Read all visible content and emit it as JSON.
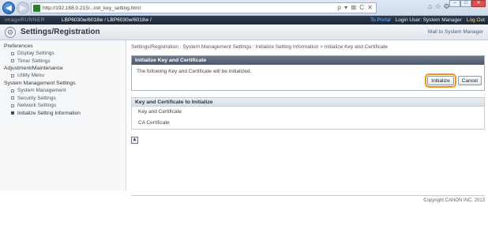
{
  "browser": {
    "url": "http://192.168.0.215/...init_key_setting.html",
    "addr_tools": "ρ ▾ ⊠ C ✕",
    "tab_tools": [
      "⌂",
      "☆",
      "⚙"
    ]
  },
  "device": {
    "logo": "imageRUNNER",
    "name": "LBP6030w/6018w / LBP6030w/6018w /",
    "portal": "To Portal",
    "login_user": "Login User: System Manager",
    "logout": "Log Out"
  },
  "header": {
    "title": "Settings/Registration",
    "mail_link": "Mail to System Manager"
  },
  "sidebar": [
    {
      "type": "head",
      "label": "Preferences"
    },
    {
      "type": "item",
      "label": "Display Settings"
    },
    {
      "type": "item",
      "label": "Timer Settings"
    },
    {
      "type": "head",
      "label": "Adjustment/Maintenance"
    },
    {
      "type": "item",
      "label": "Utility Menu"
    },
    {
      "type": "head",
      "label": "System Management Settings"
    },
    {
      "type": "item",
      "label": "System Management"
    },
    {
      "type": "item",
      "label": "Security Settings"
    },
    {
      "type": "item",
      "label": "Network Settings"
    },
    {
      "type": "item",
      "label": "Initialize Setting Information",
      "active": true
    }
  ],
  "main": {
    "breadcrumb": "Settings/Registration : System Management Settings : Initialize Setting Information > Initialize Key and Certificate",
    "panel_title": "Initialize Key and Certificate",
    "message": "The following Key and Certificate will be initialized.",
    "initialize_label": "Initialize",
    "cancel_label": "Cancel",
    "section_title": "Key and Certificate to Initialize",
    "rows": [
      "Key and Certificate",
      "CA Certificate"
    ],
    "top_icon": "▲"
  },
  "footer": {
    "copyright": "Copyright CANON INC. 2013"
  }
}
